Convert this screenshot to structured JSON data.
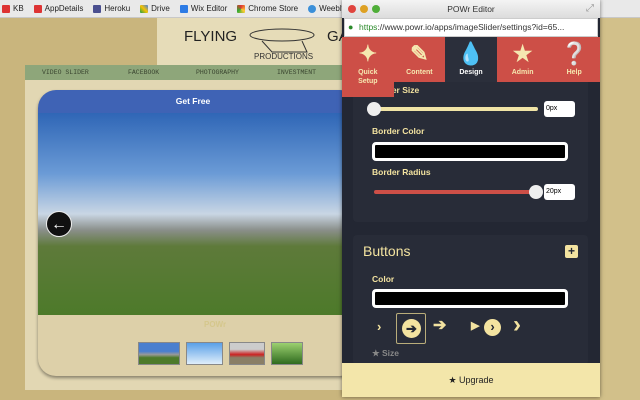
{
  "bookmarks": [
    "KB",
    "AppDetails",
    "Heroku",
    "Drive",
    "Wix Editor",
    "Chrome Store",
    "Weebly E"
  ],
  "site": {
    "logo": {
      "left": "FLYING",
      "right": "GA",
      "sub": "PRODUCTIONS"
    },
    "nav": [
      "VIDEO SLIDER",
      "FACEBOOK",
      "PHOTOGRAPHY",
      "INVESTMENT"
    ],
    "slider": {
      "banner": "Get Free",
      "watermark": "POWr",
      "back_icon": "arrow-left-circle-icon",
      "thumbnails": [
        "mountain hikers",
        "skydiver",
        "red cars",
        "forest path"
      ]
    }
  },
  "popup": {
    "title": "POWr Editor",
    "url_scheme": "https",
    "url_rest": "://www.powr.io/apps/imageSlider/settings?id=65...",
    "tabs": [
      {
        "label": "Quick Setup",
        "icon": "magic-wand-icon"
      },
      {
        "label": "Content",
        "icon": "edit-icon"
      },
      {
        "label": "Design",
        "icon": "drop-icon",
        "active": true
      },
      {
        "label": "Admin",
        "icon": "star-icon"
      },
      {
        "label": "Help",
        "icon": "question-icon"
      }
    ],
    "border": {
      "size_label": "Border Size",
      "size_value": "0px",
      "size_fraction": 0,
      "color_label": "Border Color",
      "color": "#000000",
      "radius_label": "Border Radius",
      "radius_value": "20px",
      "radius_fraction": 1
    },
    "buttons": {
      "title": "Buttons",
      "color_label": "Color",
      "color": "#000000",
      "size_label": "Size",
      "arrow_styles": [
        "chevron-small",
        "circle-arrow",
        "arrow",
        "triangle",
        "circle-chevron",
        "chevron-large"
      ],
      "selected_style": "circle-arrow"
    },
    "upgrade": "Upgrade"
  },
  "colors": {
    "accent_red": "#cd4f47",
    "panel_dark": "#232733",
    "label_yellow": "#f3e3a0",
    "banner_blue": "#3f63b5"
  }
}
